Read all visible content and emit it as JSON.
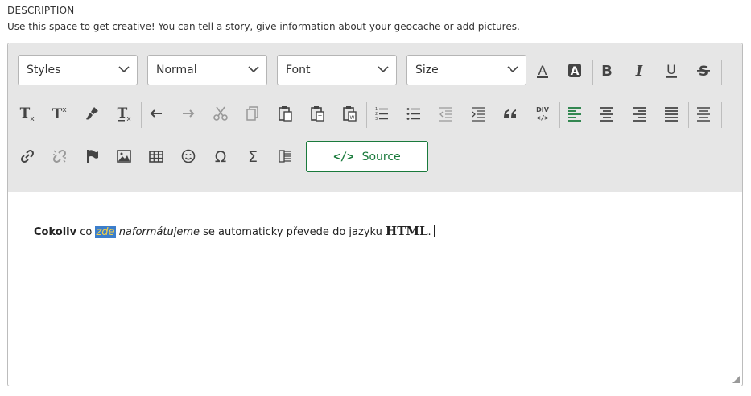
{
  "section": {
    "title": "DESCRIPTION",
    "description": "Use this space to get creative! You can tell a story, give information about your geocache or add pictures."
  },
  "toolbar": {
    "combos": {
      "styles": "Styles",
      "format": "Normal",
      "font": "Font",
      "size": "Size"
    },
    "source_label": "Source",
    "source_code": "</>",
    "div_top": "DIV",
    "div_bottom": "</>"
  },
  "editor": {
    "word1": "Cokoliv",
    "word2": " co ",
    "highlight": "zde",
    "word3": " ",
    "italic": "naformátujeme",
    "word4": " se automaticky převede do jazyku ",
    "html_word": "HTML",
    "word5": "."
  },
  "colors": {
    "accent": "#1a7a3c",
    "highlight_bg": "#3c7ecb",
    "highlight_text": "#f2d04a",
    "toolbar_bg": "#e6e6e6"
  }
}
